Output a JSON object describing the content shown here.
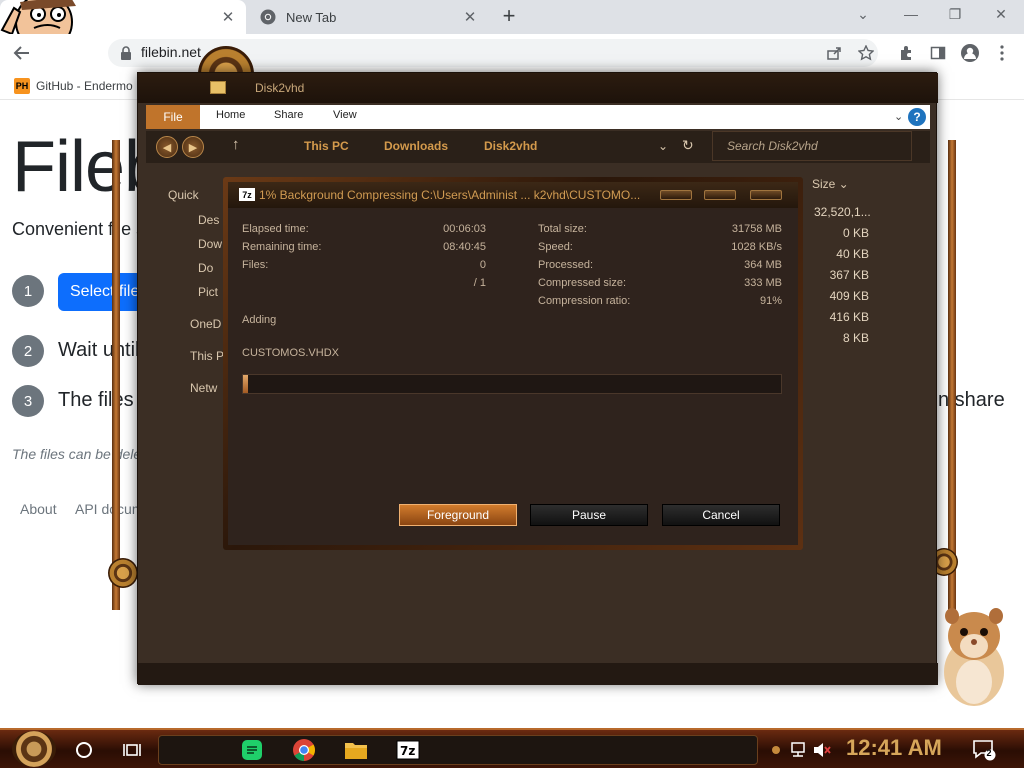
{
  "browser": {
    "tabs": [
      {
        "title": "",
        "close_glyph": "✕"
      },
      {
        "title": "New Tab",
        "close_glyph": "✕"
      }
    ],
    "new_tab_glyph": "+",
    "window_controls": {
      "collapse": "⌄",
      "minimize": "—",
      "restore": "❐",
      "close": "✕"
    },
    "url": "filebin.net",
    "bookmark": {
      "badge": "PH",
      "label": "GitHub - Endermo"
    }
  },
  "page": {
    "title": "Filebin",
    "tagline": "Convenient file sharing in",
    "steps": [
      {
        "number": "1",
        "text": "Select files to upl"
      },
      {
        "number": "2",
        "text": "Wait until"
      },
      {
        "number": "3",
        "text": "The files will be ava"
      }
    ],
    "step3_tail": "n share",
    "note": "The files can be deleted from",
    "footer": {
      "about": "About",
      "api": "API documentation"
    }
  },
  "explorer": {
    "title": "Disk2vhd",
    "menu": {
      "file": "File",
      "home": "Home",
      "share": "Share",
      "view": "View"
    },
    "breadcrumb": [
      "This PC",
      "Downloads",
      "Disk2vhd"
    ],
    "search_placeholder": "Search Disk2vhd",
    "column_size": "Size",
    "sizes": [
      "32,520,1...",
      "0 KB",
      "40 KB",
      "367 KB",
      "409 KB",
      "416 KB",
      "8 KB"
    ],
    "nav": [
      "Quick",
      "Des",
      "Dow",
      "Do",
      "Pict",
      "OneD",
      "This P",
      "Netw"
    ]
  },
  "zip_dialog": {
    "icon_label": "7z",
    "title": "1% Background Compressing C:\\Users\\Administ ... k2vhd\\CUSTOMO...",
    "elapsed_label": "Elapsed time:",
    "elapsed_value": "00:06:03",
    "remaining_label": "Remaining time:",
    "remaining_value": "08:40:45",
    "files_label": "Files:",
    "files_value": "0",
    "files_total": "/ 1",
    "total_size_label": "Total size:",
    "total_size_value": "31758 MB",
    "speed_label": "Speed:",
    "speed_value": "1028 KB/s",
    "processed_label": "Processed:",
    "processed_value": "364 MB",
    "compressed_label": "Compressed size:",
    "compressed_value": "333 MB",
    "ratio_label": "Compression ratio:",
    "ratio_value": "91%",
    "status": "Adding",
    "current_file": "CUSTOMOS.VHDX",
    "progress_percent": 1,
    "buttons": {
      "foreground": "Foreground",
      "pause": "Pause",
      "cancel": "Cancel"
    }
  },
  "taskbar": {
    "clock": "12:41 AM",
    "notification_count": "2",
    "pinned": [
      "green-app-icon",
      "chrome-icon",
      "file-explorer-icon",
      "7zip-icon"
    ]
  },
  "colors": {
    "accent_copper": "#c0742b",
    "filebin_blue": "#0d6efd",
    "dialog_bg": "#2f231d",
    "clock_gold": "#d6a65a"
  }
}
